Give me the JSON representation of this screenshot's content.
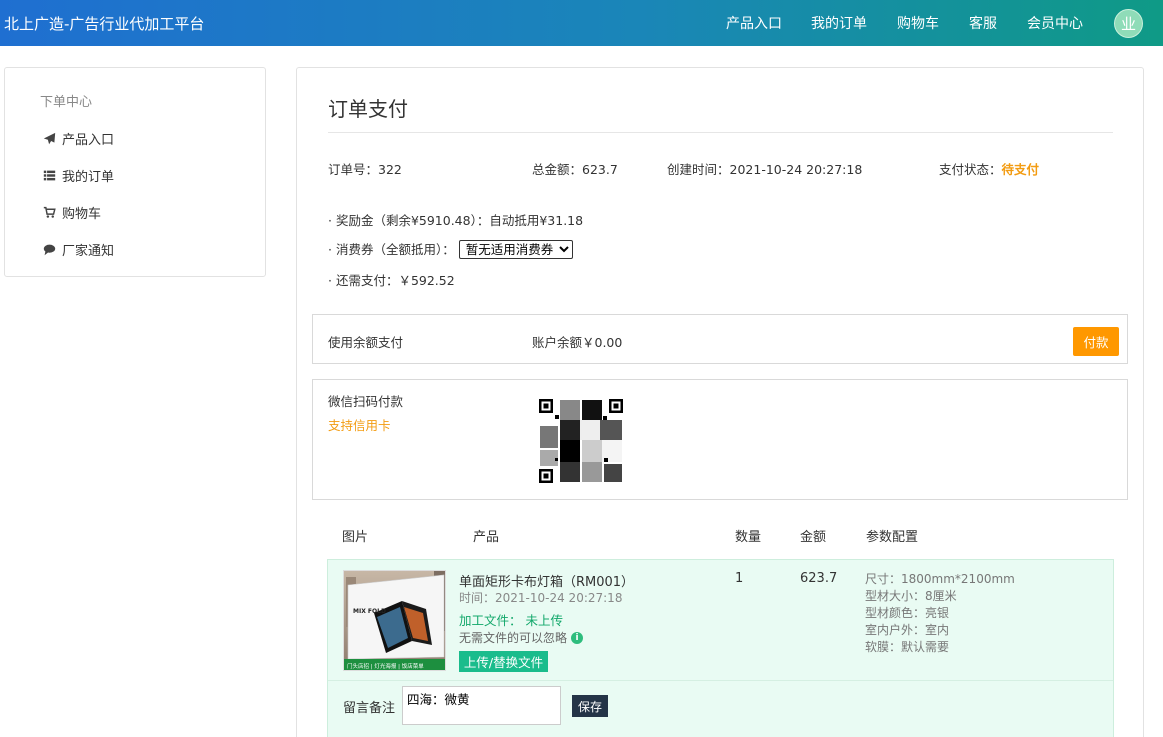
{
  "header": {
    "brand": "北上广造-广告行业代加工平台",
    "nav": [
      "产品入口",
      "我的订单",
      "购物车",
      "客服",
      "会员中心"
    ],
    "avatar_text": "业"
  },
  "sidebar": {
    "title": "下单中心",
    "items": [
      {
        "label": "产品入口",
        "icon": "paper-plane-icon"
      },
      {
        "label": "我的订单",
        "icon": "list-icon"
      },
      {
        "label": "购物车",
        "icon": "cart-icon"
      },
      {
        "label": "厂家通知",
        "icon": "comment-icon"
      }
    ]
  },
  "page": {
    "title": "订单支付",
    "order_no_label": "订单号：",
    "order_no": "322",
    "total_label": "总金额：",
    "total": "623.7",
    "created_label": "创建时间：",
    "created": "2021-10-24 20:27:18",
    "status_label": "支付状态：",
    "status": "待支付",
    "status_color": "#f39c12"
  },
  "discounts": {
    "bonus": "· 奖励金（剩余¥5910.48）：自动抵用¥31.18",
    "coupon_label": "· 消费券（全额抵用）：",
    "coupon_selected": "暂无适用消费券",
    "remaining": "· 还需支付：￥592.52"
  },
  "balance_pay": {
    "label": "使用余额支付",
    "balance": "账户余额￥0.00",
    "button": "付款"
  },
  "wechat_pay": {
    "label": "微信扫码付款",
    "credit_note": "支持信用卡"
  },
  "table": {
    "headers": [
      "图片",
      "产品",
      "数量",
      "金额",
      "参数配置"
    ],
    "item": {
      "name": "单面矩形卡布灯箱（RM001）",
      "time": "时间：2021-10-24 20:27:18",
      "file_status": "加工文件：  未上传",
      "file_note": "无需文件的可以忽略",
      "upload_button": "上传/替换文件",
      "qty": "1",
      "amount": "623.7",
      "params": [
        "尺寸：1800mm*2100mm",
        "型材大小：8厘米",
        "型材颜色：亮银",
        "室内户外：室内",
        "软膜：默认需要"
      ],
      "thumb_caption": "门头店招 | 灯光海报 | 饭店菜单",
      "thumb_brand": "MIX FOLD"
    },
    "remark_label": "留言备注",
    "remark_value": "四海：微黄",
    "save_button": "保存"
  }
}
